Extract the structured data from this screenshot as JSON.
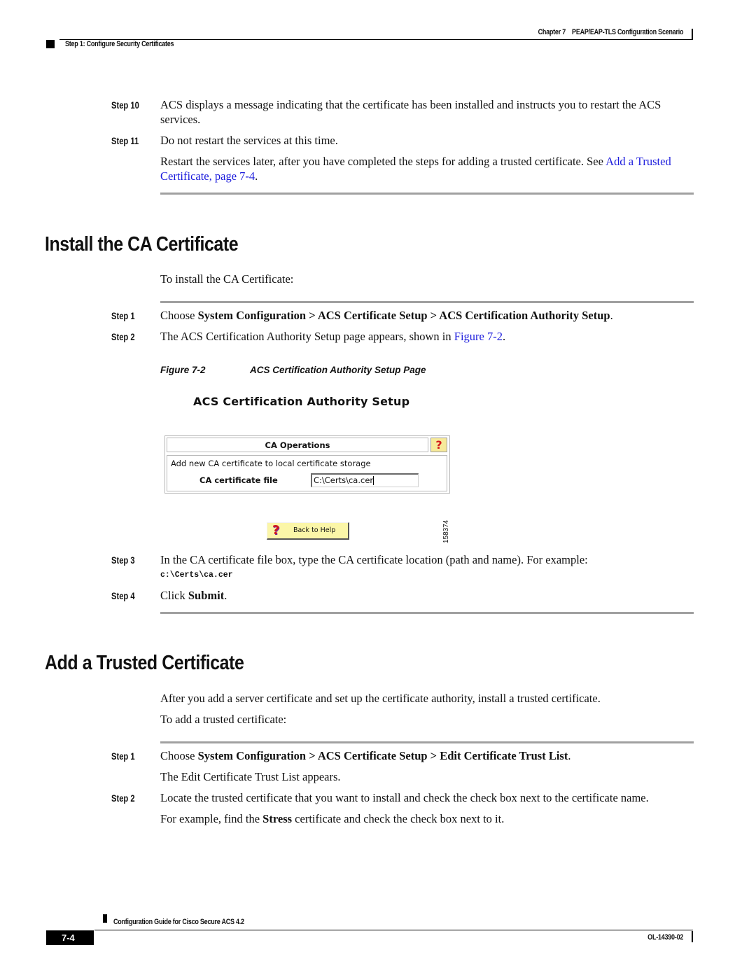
{
  "header": {
    "chapter": "Chapter 7",
    "chapter_title": "PEAP/EAP-TLS Configuration Scenario",
    "section": "Step 1: Configure Security Certificates"
  },
  "intro_steps": [
    {
      "label": "Step 10",
      "text": "ACS displays a message indicating that the certificate has been installed and instructs you to restart the ACS services."
    },
    {
      "label": "Step 11",
      "text": "Do not restart the services at this time."
    }
  ],
  "intro_note": {
    "text_before": "Restart the services later, after you have completed the steps for adding a trusted certificate. See ",
    "link_part1": "Add a",
    "link_part2": "Trusted Certificate, page 7-4",
    "text_after": "."
  },
  "section_install": {
    "heading": "Install the CA Certificate",
    "intro": "To install the CA Certificate:",
    "step1": {
      "label": "Step 1",
      "prefix": "Choose ",
      "path": "System Configuration > ACS Certificate Setup > ACS Certification Authority Setup",
      "suffix": "."
    },
    "step2": {
      "label": "Step 2",
      "prefix": "The ACS Certification Authority Setup page appears, shown in ",
      "link": "Figure 7-2",
      "suffix": "."
    },
    "figure": {
      "caption_number": "Figure 7-2",
      "caption_title": "ACS Certification Authority Setup Page",
      "page_title": "ACS Certification Authority Setup",
      "table_header": "CA Operations",
      "help_icon": "?",
      "description": "Add new CA certificate to local certificate storage",
      "field_label": "CA certificate file",
      "field_value": "C:\\Certs\\ca.cer",
      "back_button_label": "Back to Help",
      "figure_id": "158374"
    },
    "step3": {
      "label": "Step 3",
      "text": "In the CA certificate file box, type the CA certificate location (path and name). For example:",
      "example": "c:\\Certs\\ca.cer"
    },
    "step4": {
      "label": "Step 4",
      "prefix": "Click ",
      "bold": "Submit",
      "suffix": "."
    }
  },
  "section_trusted": {
    "heading": "Add a Trusted Certificate",
    "intro1": "After you add a server certificate and set up the certificate authority, install a trusted certificate.",
    "intro2": "To add a trusted certificate:",
    "step1": {
      "label": "Step 1",
      "prefix": "Choose ",
      "path": "System Configuration > ACS Certificate Setup > Edit Certificate Trust List",
      "suffix": ".",
      "result": "The Edit Certificate Trust List appears."
    },
    "step2": {
      "label": "Step 2",
      "text": "Locate the trusted certificate that you want to install and check the check box next to the certificate name.",
      "example_prefix": "For example, find the ",
      "example_bold": "Stress",
      "example_suffix": " certificate and check the check box next to it."
    }
  },
  "footer": {
    "guide_title": "Configuration Guide for Cisco Secure ACS 4.2",
    "page_number": "7-4",
    "doc_number": "OL-14390-02"
  }
}
